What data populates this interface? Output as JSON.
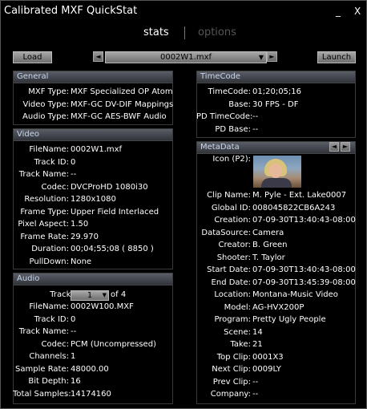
{
  "window": {
    "title": "Calibrated MXF QuickStat",
    "minimize": "_",
    "close": "X"
  },
  "tabs": {
    "stats": "stats",
    "options": "options"
  },
  "toolbar": {
    "load": "Load",
    "launch": "Launch",
    "file": "0002W1.mxf",
    "prev": "◄",
    "next": "►",
    "caret": "▼"
  },
  "general": {
    "header": "General",
    "rows": [
      {
        "label": "MXF Type:",
        "value": "MXF Specialized OP Atom"
      },
      {
        "label": "Video Type:",
        "value": "MXF-GC DV-DIF Mappings"
      },
      {
        "label": "Audio Type:",
        "value": "MXF-GC AES-BWF Audio"
      }
    ]
  },
  "video": {
    "header": "Video",
    "rows": [
      {
        "label": "FileName:",
        "value": "0002W1.mxf"
      },
      {
        "label": "Track ID:",
        "value": "0"
      },
      {
        "label": "Track Name:",
        "value": "--"
      },
      {
        "label": "Codec:",
        "value": "DVCProHD 1080i30"
      },
      {
        "label": "Resolution:",
        "value": "1280x1080"
      },
      {
        "label": "Frame Type:",
        "value": "Upper Field Interlaced"
      },
      {
        "label": "Pixel Aspect:",
        "value": "1.50"
      },
      {
        "label": "Frame Rate:",
        "value": "29.970"
      },
      {
        "label": "Duration:",
        "value": "00;04;55;08 ( 8850 )"
      },
      {
        "label": "PullDown:",
        "value": "None"
      }
    ]
  },
  "audio": {
    "header": "Audio",
    "track_label": "Track #",
    "track_value": "1",
    "track_of": "of 4",
    "rows": [
      {
        "label": "FileName:",
        "value": "0002W100.MXF"
      },
      {
        "label": "Track ID:",
        "value": "0"
      },
      {
        "label": "Track Name:",
        "value": "--"
      },
      {
        "label": "Codec:",
        "value": "PCM (Uncompressed)"
      },
      {
        "label": "Channels:",
        "value": "1"
      },
      {
        "label": "Sample Rate:",
        "value": "48000.00"
      },
      {
        "label": "Bit Depth:",
        "value": "16"
      },
      {
        "label": "Total Samples:",
        "value": "14174160"
      }
    ]
  },
  "timecode": {
    "header": "TimeCode",
    "rows": [
      {
        "label": "TimeCode:",
        "value": "01;20;05;16"
      },
      {
        "label": "Base:",
        "value": "30 FPS - DF"
      },
      {
        "label": "PD TimeCode:",
        "value": "--"
      },
      {
        "label": "PD Base:",
        "value": "--"
      }
    ]
  },
  "metadata": {
    "header": "MetaData",
    "icon_label": "Icon (P2):",
    "rows": [
      {
        "label": "Clip Name:",
        "value": "M. Pyle - Ext. Lake0007"
      },
      {
        "label": "Global ID:",
        "value": "008045822CB6A243"
      },
      {
        "label": "Creation:",
        "value": "07-09-30T13:40:43-08:00"
      },
      {
        "label": "DataSource:",
        "value": "Camera"
      },
      {
        "label": "Creator:",
        "value": "B. Green"
      },
      {
        "label": "Shooter:",
        "value": "T. Taylor"
      },
      {
        "label": "Start Date:",
        "value": "07-09-30T13:40:43-08:00"
      },
      {
        "label": "End Date:",
        "value": "07-09-30T13:45:39-08:00"
      },
      {
        "label": "Location:",
        "value": "Montana-Music Video"
      },
      {
        "label": "Model:",
        "value": "AG-HVX200P"
      },
      {
        "label": "Program:",
        "value": "Pretty Ugly People"
      },
      {
        "label": "Scene:",
        "value": "14"
      },
      {
        "label": "Take:",
        "value": "21"
      },
      {
        "label": "Top Clip:",
        "value": "0001X3"
      },
      {
        "label": "Next Clip:",
        "value": "0009LY"
      },
      {
        "label": "Prev Clip:",
        "value": "--"
      },
      {
        "label": "Company:",
        "value": "--"
      }
    ]
  }
}
